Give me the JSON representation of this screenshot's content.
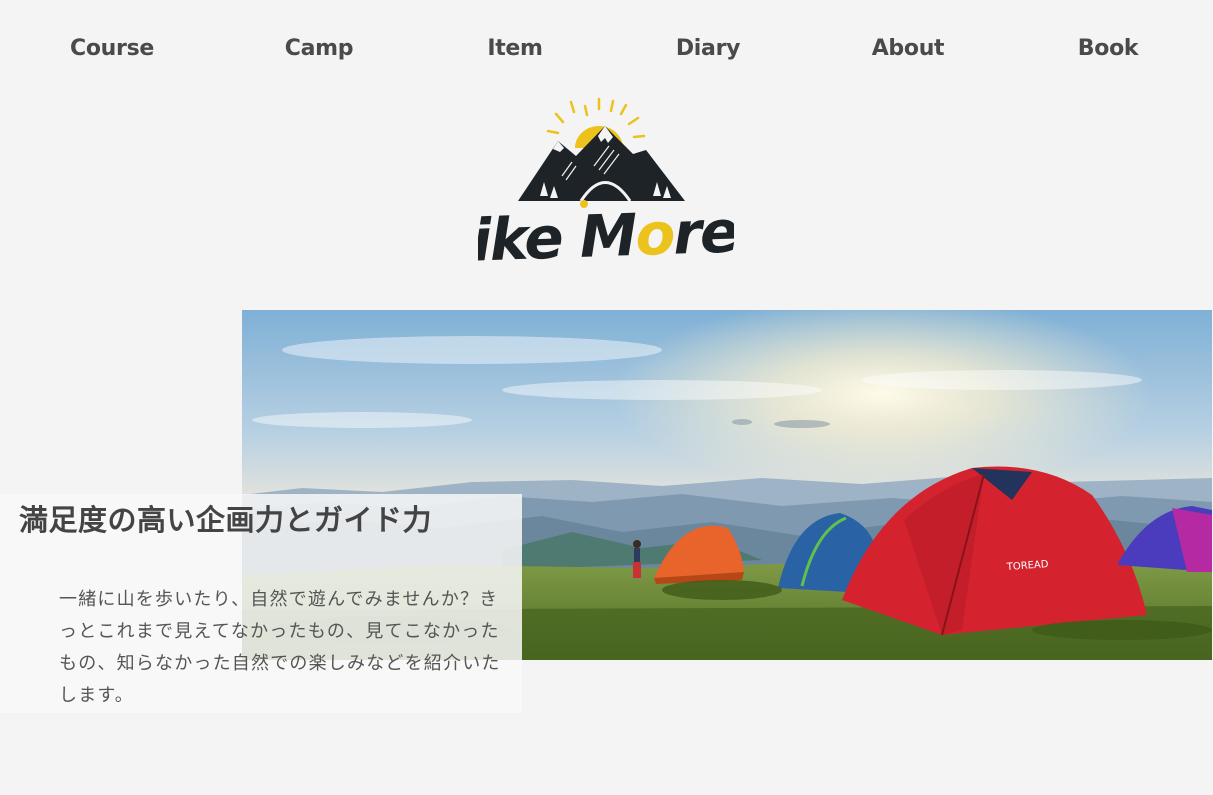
{
  "nav": {
    "items": [
      {
        "label": "Course"
      },
      {
        "label": "Camp"
      },
      {
        "label": "Item"
      },
      {
        "label": "Diary"
      },
      {
        "label": "About"
      },
      {
        "label": "Book"
      }
    ]
  },
  "logo": {
    "text": "Hike More!!",
    "colors": {
      "dark": "#1e2328",
      "accent": "#ecc21c"
    }
  },
  "hero": {
    "image_subject": "tents on a mountain meadow at sunrise",
    "tent_brand": "TOREAD"
  },
  "intro": {
    "heading": "満足度の高い企画力とガイド力",
    "body": "一緒に山を歩いたり、自然で遊んでみませんか？きっとこれまで見えてなかったもの、見てこなかったもの、知らなかった自然での楽しみなどを紹介いたします。"
  },
  "colors": {
    "page_bg": "#f4f4f4",
    "text": "#4a4a4a"
  }
}
